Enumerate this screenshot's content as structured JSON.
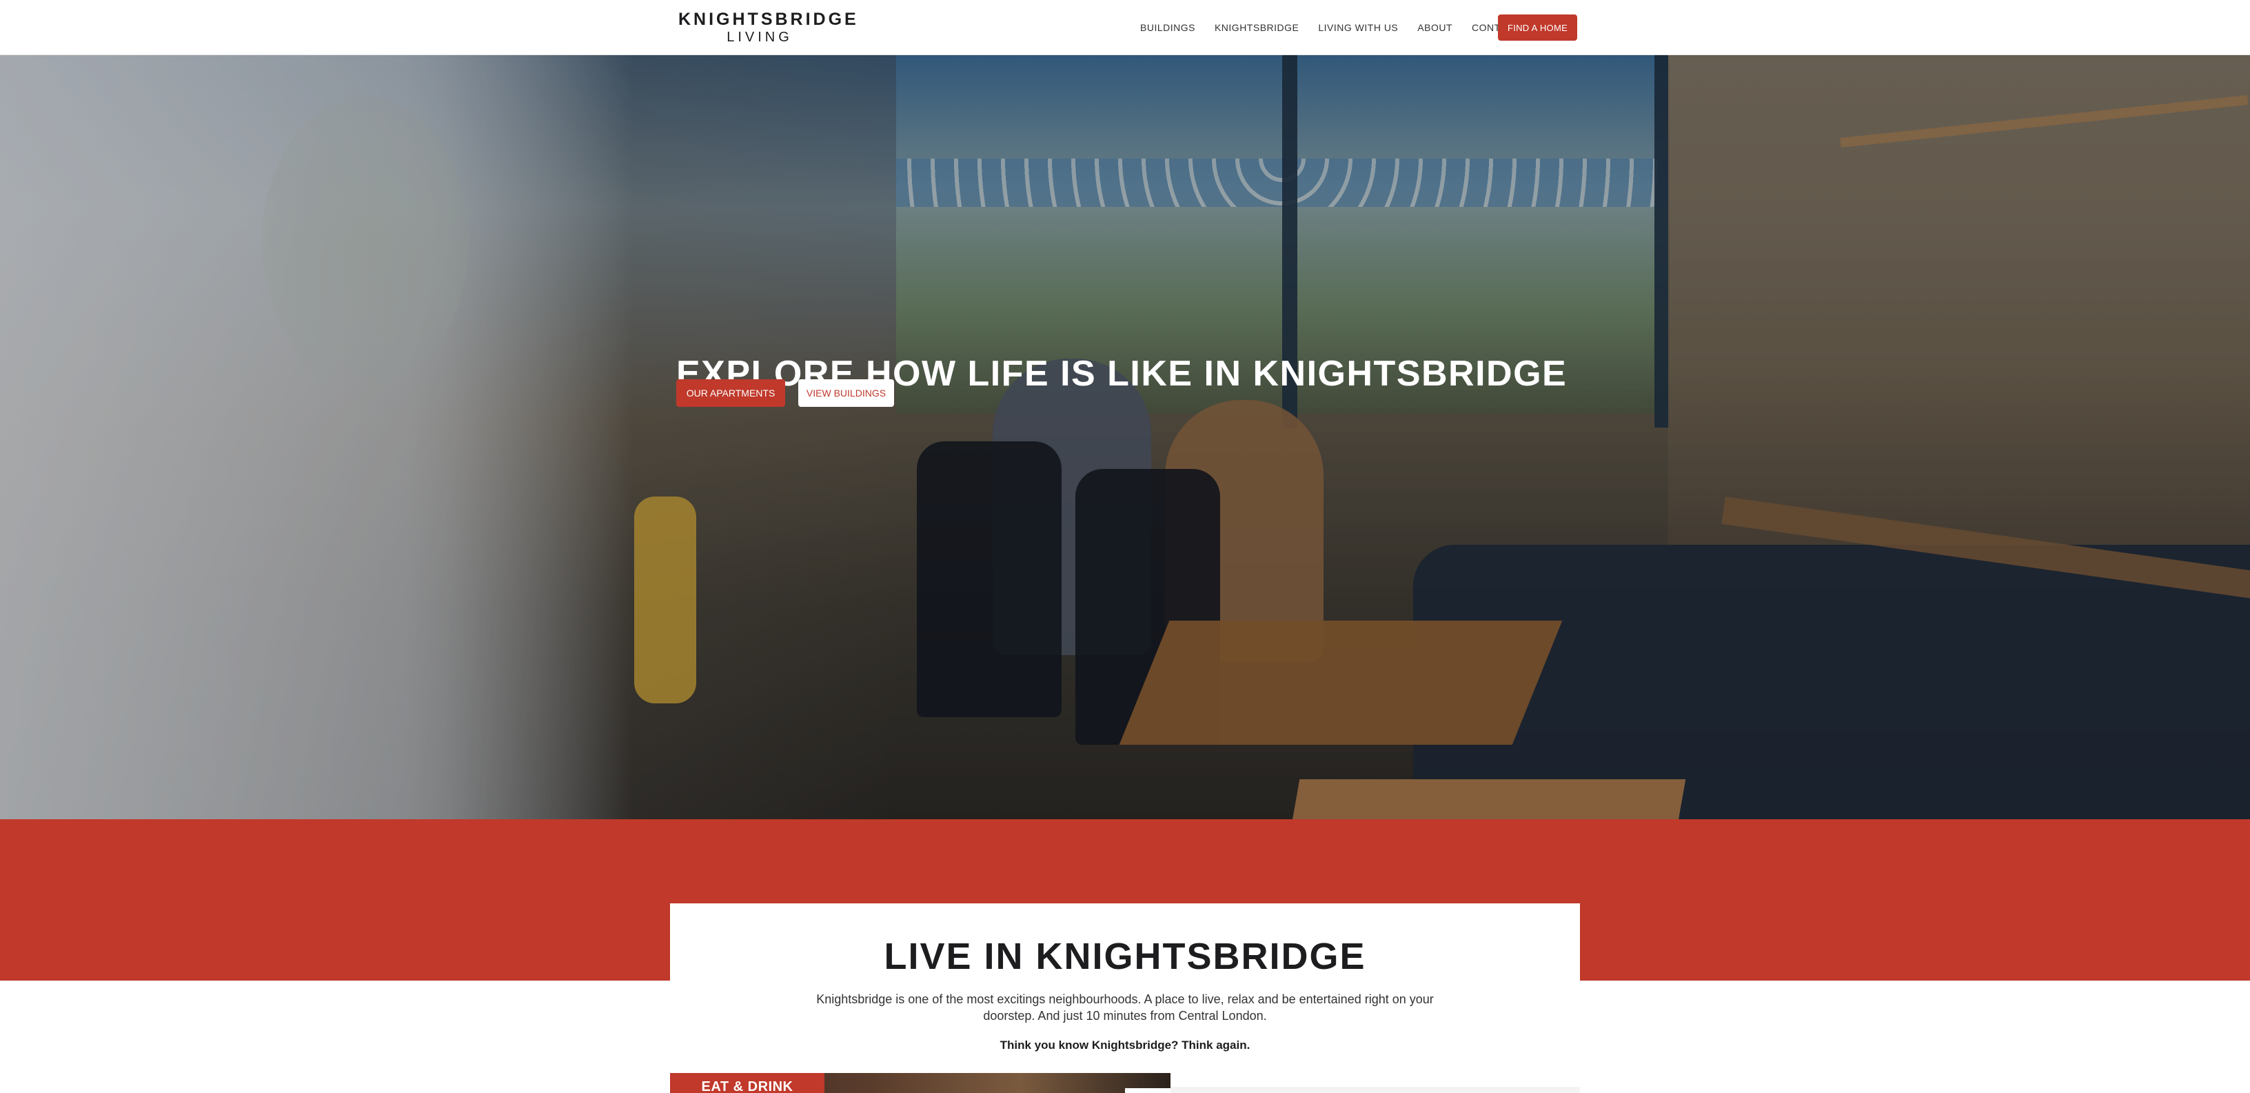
{
  "header": {
    "logo_line1": "KNIGHTSBRIDGE",
    "logo_line2": "LIVING",
    "nav": [
      "BUILDINGS",
      "KNIGHTSBRIDGE",
      "LIVING WITH US",
      "ABOUT",
      "CONTACT"
    ],
    "cta_label": "FIND A HOME"
  },
  "hero": {
    "title": "EXPLORE HOW LIFE IS LIKE IN KNIGHTSBRIDGE",
    "primary_button": "OUR APARTMENTS",
    "secondary_button": "VIEW BUILDINGS"
  },
  "section": {
    "title": "LIVE IN KNIGHTSBRIDGE",
    "text": "Knightsbridge is one of the most excitings neighbourhoods. A place to live, relax and be entertained right on your doorstep. And just 10 minutes from Central London.",
    "strong": "Think you know Knightsbridge? Think again.",
    "tile_label": "EAT & DRINK"
  },
  "colors": {
    "accent": "#c0392b",
    "text": "#1d1d1f",
    "background": "#ffffff"
  }
}
